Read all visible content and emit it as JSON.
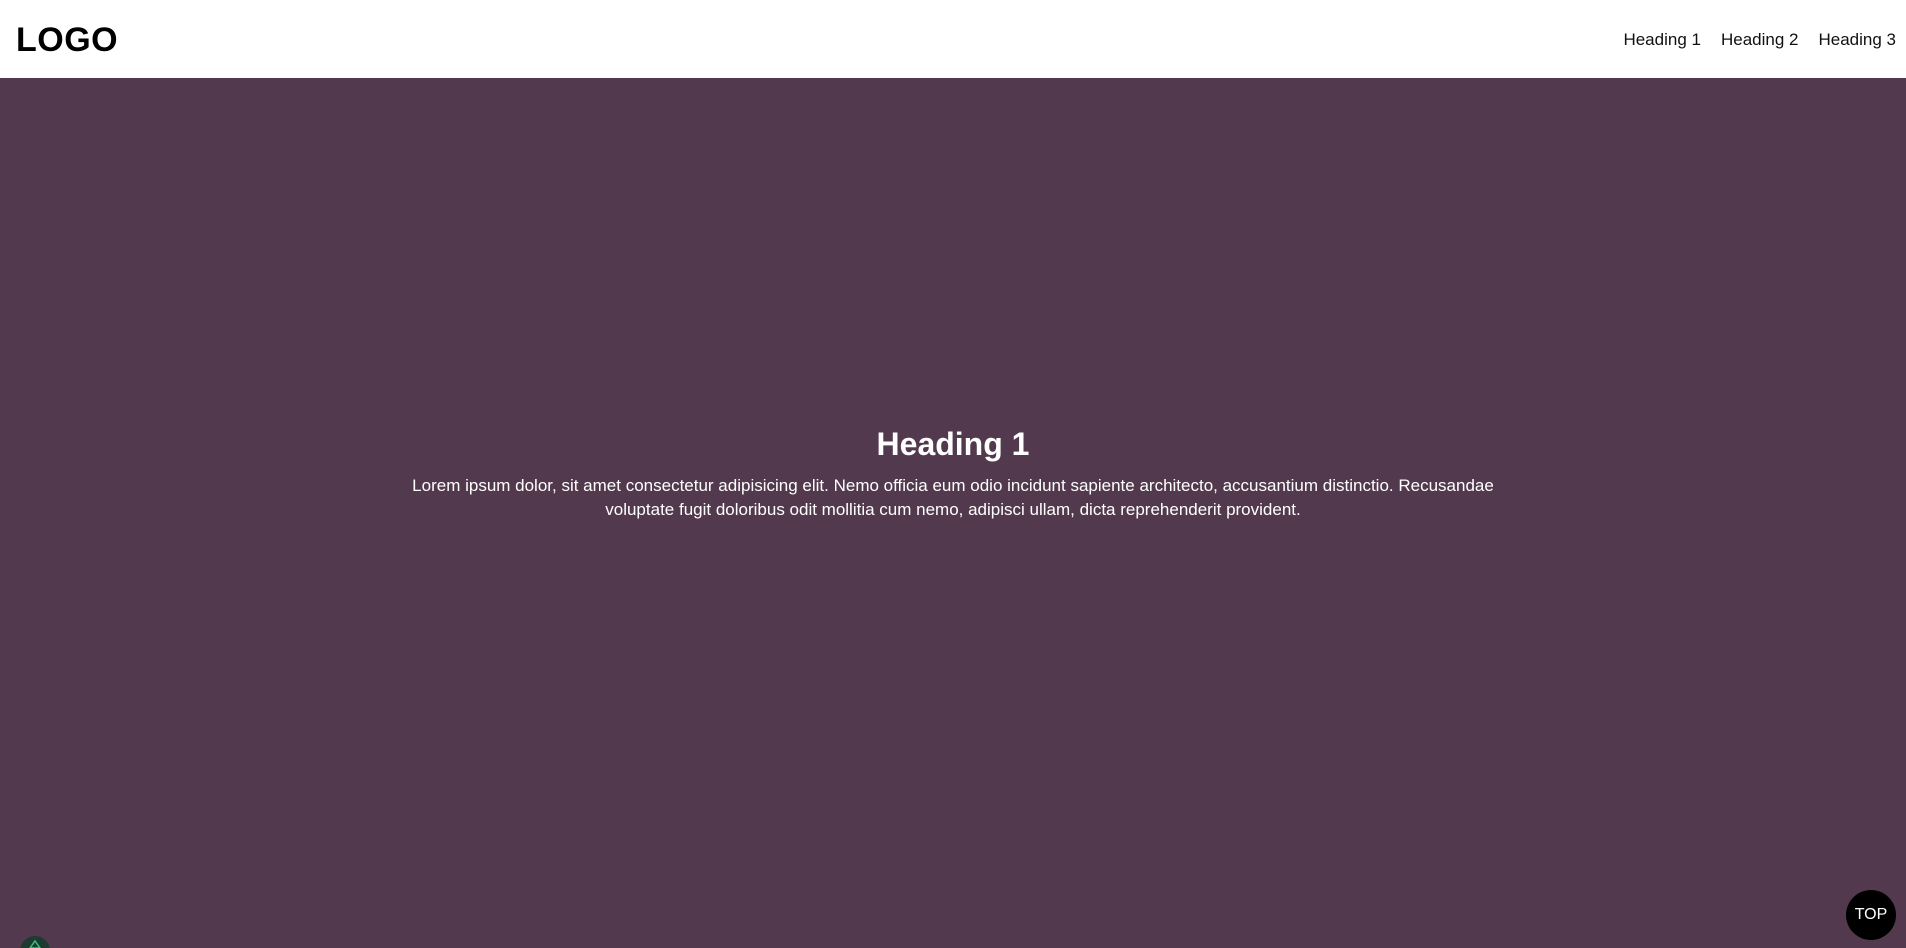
{
  "header": {
    "logo": "LOGO",
    "nav": [
      {
        "label": "Heading 1"
      },
      {
        "label": "Heading 2"
      },
      {
        "label": "Heading 3"
      }
    ]
  },
  "hero": {
    "title": "Heading 1",
    "text": "Lorem ipsum dolor, sit amet consectetur adipisicing elit. Nemo officia eum odio incidunt sapiente architecto, accusantium distinctio. Recusandae voluptate fugit doloribus odit mollitia cum nemo, adipisci ullam, dicta reprehenderit provident.",
    "background_color": "#52394e"
  },
  "scroll_top": {
    "label": "TOP"
  },
  "corner_widget": {
    "icon": "arrow-up-icon",
    "color": "#1d3b2f"
  }
}
